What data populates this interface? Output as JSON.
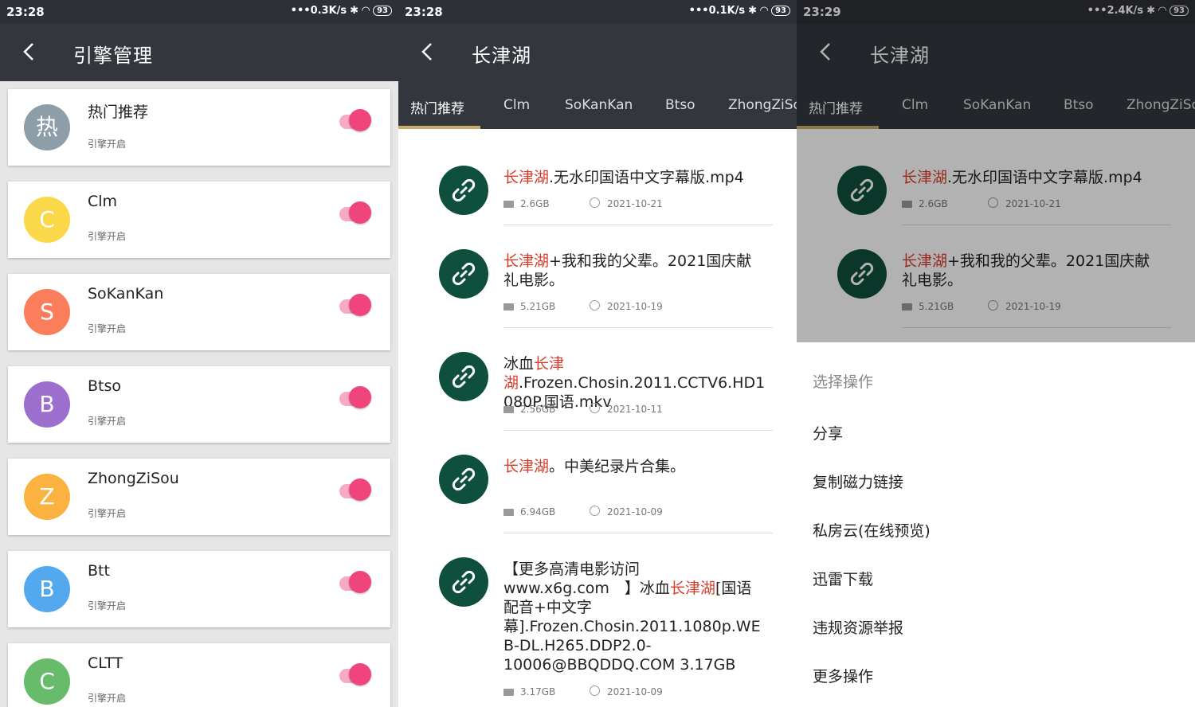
{
  "status": [
    {
      "time": "23:28",
      "net": "•••0.3K/s",
      "battery": "93"
    },
    {
      "time": "23:28",
      "net": "•••0.1K/s",
      "battery": "93"
    },
    {
      "time": "23:29",
      "net": "•••2.4K/s",
      "battery": "93"
    }
  ],
  "engine": {
    "title": "引擎管理",
    "items": [
      {
        "initial": "热",
        "name": "热门推荐",
        "status": "引擎开启",
        "color": "#8e9ea8"
      },
      {
        "initial": "C",
        "name": "Clm",
        "status": "引擎开启",
        "color": "#fbd84a"
      },
      {
        "initial": "S",
        "name": "SoKanKan",
        "status": "引擎开启",
        "color": "#fb7e5c"
      },
      {
        "initial": "B",
        "name": "Btso",
        "status": "引擎开启",
        "color": "#9c6fce"
      },
      {
        "initial": "Z",
        "name": "ZhongZiSou",
        "status": "引擎开启",
        "color": "#fcb240"
      },
      {
        "initial": "B",
        "name": "Btt",
        "status": "引擎开启",
        "color": "#54a8ee"
      },
      {
        "initial": "C",
        "name": "CLTT",
        "status": "引擎开启",
        "color": "#67bb6a"
      }
    ]
  },
  "search": {
    "title": "长津湖",
    "tabs": [
      "热门推荐",
      "Clm",
      "SoKanKan",
      "Btso",
      "ZhongZiSou"
    ],
    "results": [
      {
        "hl": "长津湖",
        "rest": ".无水印国语中文字幕版.mp4",
        "size": "2.6GB",
        "date": "2021-10-21"
      },
      {
        "hl": "长津湖",
        "rest": "+我和我的父辈。2021国庆献礼电影。",
        "size": "5.21GB",
        "date": "2021-10-19"
      },
      {
        "pre": "冰血",
        "hl": "长津湖",
        "rest": ".Frozen.Chosin.2011.CCTV6.HD1080P.国语.mkv",
        "size": "2.56GB",
        "date": "2021-10-11"
      },
      {
        "hl": "长津湖",
        "rest": "。中美纪录片合集。",
        "size": "6.94GB",
        "date": "2021-10-09"
      },
      {
        "pre": "【更多高清电影访问　www.x6g.com　】冰血",
        "hl": "长津湖",
        "rest": "[国语配音+中文字幕].Frozen.Chosin.2011.1080p.WEB-DL.H265.DDP2.0-10006@BBQDDQ.COM 3.17GB",
        "size": "3.17GB",
        "date": "2021-10-09"
      }
    ]
  },
  "sheet": {
    "title": "选择操作",
    "items": [
      "分享",
      "复制磁力链接",
      "私房云(在线预览)",
      "迅雷下载",
      "违规资源举报",
      "更多操作"
    ]
  }
}
